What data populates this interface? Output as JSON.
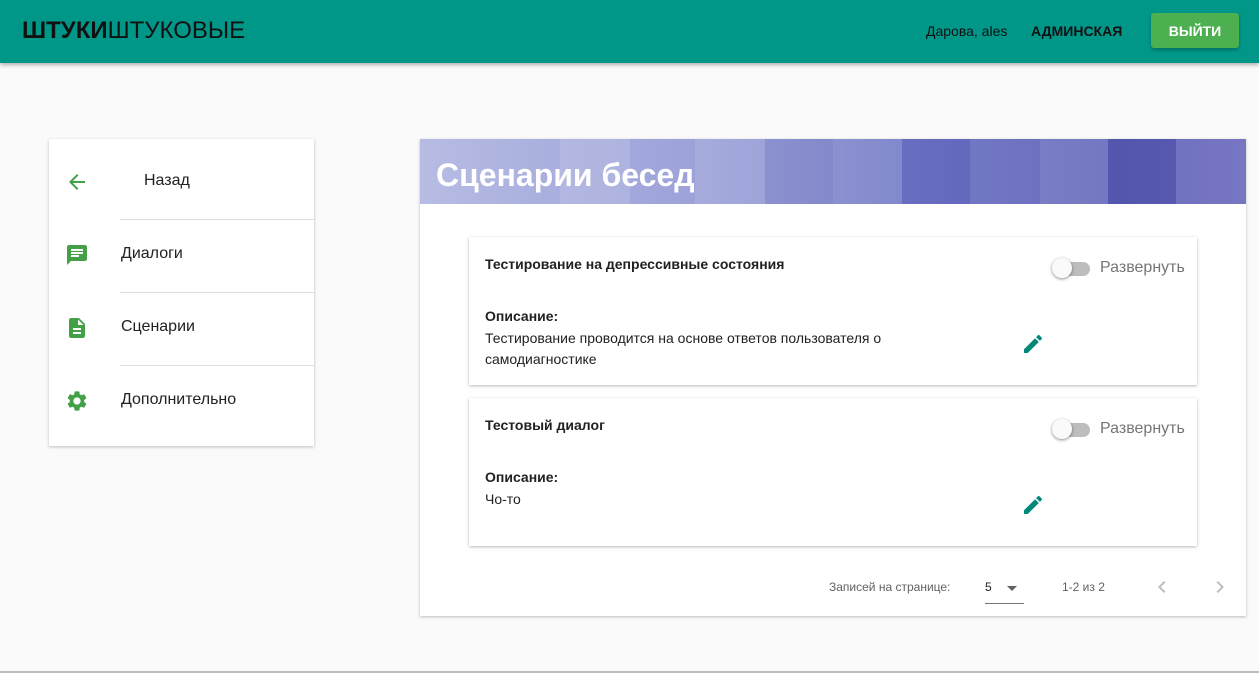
{
  "appbar": {
    "brand_bold": "ШТУКИ",
    "brand_light": "ШТУКОВЫЕ",
    "greeting": "Дарова, ales",
    "admin_link": "АДМИНСКАЯ",
    "logout_label": "ВЫЙТИ",
    "color": "#009688"
  },
  "sidebar": {
    "items": [
      {
        "label": "Назад",
        "icon": "arrow-back-icon"
      },
      {
        "label": "Диалоги",
        "icon": "chat-icon"
      },
      {
        "label": "Сценарии",
        "icon": "document-icon"
      },
      {
        "label": "Дополнительно",
        "icon": "gear-icon"
      }
    ],
    "icon_color": "#43a047"
  },
  "main": {
    "title": "Сценарии бесед",
    "scenarios": [
      {
        "title": "Тестирование на депрессивные состояния",
        "toggle_label": "Развернуть",
        "toggle_on": false,
        "desc_label": "Описание:",
        "desc_text": "Тестирование проводится на основе ответов пользователя о самодиагностике"
      },
      {
        "title": "Тестовый диалог",
        "toggle_label": "Развернуть",
        "toggle_on": false,
        "desc_label": "Описание:",
        "desc_text": "Чо-то"
      }
    ],
    "pagination": {
      "rows_label": "Записей на странице:",
      "rows_value": "5",
      "range": "1-2 из 2"
    },
    "accent": "#00897b"
  }
}
